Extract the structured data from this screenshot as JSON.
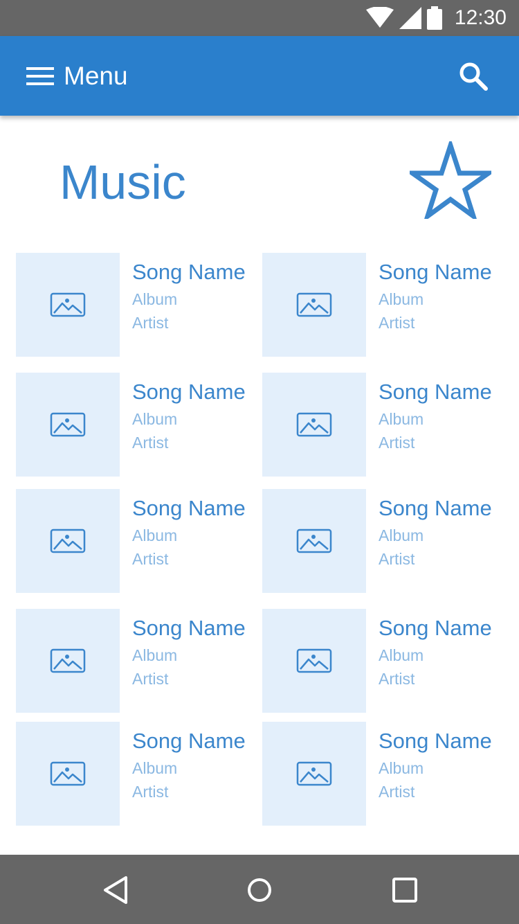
{
  "status_bar": {
    "time": "12:30",
    "icons": [
      "wifi-icon",
      "signal-icon",
      "battery-icon"
    ]
  },
  "app_bar": {
    "menu_label": "Menu",
    "icons": [
      "menu-icon",
      "search-icon"
    ]
  },
  "page": {
    "title": "Music",
    "favorite_icon": "star-outline-icon"
  },
  "songs": [
    {
      "name": "Song Name",
      "album": "Album",
      "artist": "Artist"
    },
    {
      "name": "Song Name",
      "album": "Album",
      "artist": "Artist"
    },
    {
      "name": "Song Name",
      "album": "Album",
      "artist": "Artist"
    },
    {
      "name": "Song Name",
      "album": "Album",
      "artist": "Artist"
    },
    {
      "name": "Song Name",
      "album": "Album",
      "artist": "Artist"
    },
    {
      "name": "Song Name",
      "album": "Album",
      "artist": "Artist"
    },
    {
      "name": "Song Name",
      "album": "Album",
      "artist": "Artist"
    },
    {
      "name": "Song Name",
      "album": "Album",
      "artist": "Artist"
    },
    {
      "name": "Song Name",
      "album": "Album",
      "artist": "Artist"
    },
    {
      "name": "Song Name",
      "album": "Album",
      "artist": "Artist"
    }
  ],
  "nav_bar": {
    "icons": [
      "back-icon",
      "home-icon",
      "recents-icon"
    ]
  },
  "colors": {
    "app_bar": "#2a7fcc",
    "system_bars": "#666666",
    "accent": "#3b86cc",
    "secondary_text": "#8bb8e2",
    "thumbnail_bg": "#e3effb"
  }
}
